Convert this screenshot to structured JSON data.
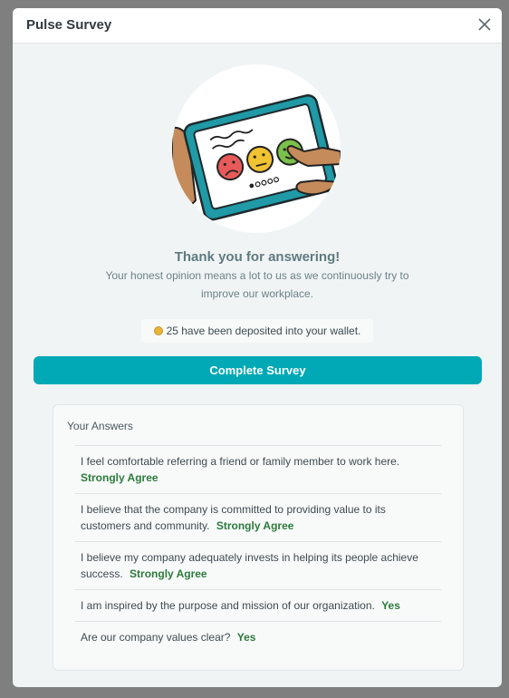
{
  "dialog": {
    "title": "Pulse Survey"
  },
  "thanks": {
    "title": "Thank you for answering!",
    "subtitle": "Your honest opinion means a lot to us as we continuously try to improve our workplace."
  },
  "wallet": {
    "message": "25 have been deposited into your wallet."
  },
  "complete_button": {
    "label": "Complete Survey"
  },
  "answers": {
    "heading": "Your Answers",
    "items": [
      {
        "question": "I feel comfortable referring a friend or family member to work here.",
        "answer": "Strongly Agree"
      },
      {
        "question": "I believe that the company is committed to providing value to its customers and community.",
        "answer": "Strongly Agree"
      },
      {
        "question": "I believe my company adequately invests in helping its people achieve success.",
        "answer": "Strongly Agree"
      },
      {
        "question": "I am inspired by the purpose and mission of our organization.",
        "answer": "Yes"
      },
      {
        "question": "Are our company values clear?",
        "answer": "Yes"
      }
    ]
  },
  "colors": {
    "accent": "#00a9b5",
    "answer_green": "#2d7a3c",
    "coin": "#e8b43a"
  }
}
